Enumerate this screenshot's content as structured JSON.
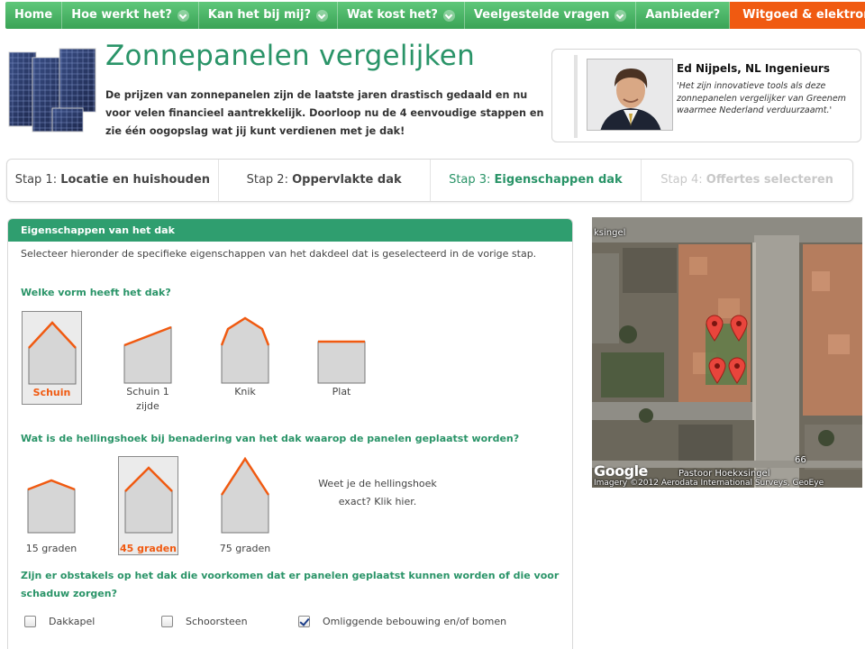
{
  "nav": {
    "items": [
      {
        "label": "Home",
        "dropdown": false
      },
      {
        "label": "Hoe werkt het?",
        "dropdown": true
      },
      {
        "label": "Kan het bij mij?",
        "dropdown": true
      },
      {
        "label": "Wat kost het?",
        "dropdown": true
      },
      {
        "label": "Veelgestelde vragen",
        "dropdown": true
      },
      {
        "label": "Aanbieder?",
        "dropdown": false
      }
    ],
    "cta": "Witgoed & elektronica"
  },
  "header": {
    "title": "Zonnepanelen vergelijken",
    "intro": "De prijzen van zonnepanelen zijn de laatste jaren drastisch gedaald en nu voor velen financieel aantrekkelijk. Doorloop nu de 4 eenvoudige stappen en zie één oogopslag wat jij kunt verdienen met je dak!"
  },
  "quote": {
    "name": "Ed Nijpels, NL Ingenieurs",
    "text": "'Het zijn innovatieve tools als deze zonnepanelen vergelijker van Greenem waarmee Nederland verduurzaamt.'"
  },
  "steps": [
    {
      "prefix": "Stap 1: ",
      "label": "Locatie en huishouden",
      "state": "done"
    },
    {
      "prefix": "Stap 2: ",
      "label": "Oppervlakte dak",
      "state": "done"
    },
    {
      "prefix": "Stap 3: ",
      "label": "Eigenschappen dak",
      "state": "active"
    },
    {
      "prefix": "Stap 4: ",
      "label": "Offertes selecteren",
      "state": "disabled"
    }
  ],
  "form": {
    "heading": "Eigenschappen van het dak",
    "subtitle": "Selecteer hieronder de specifieke eigenschappen van het dakdeel dat is geselecteerd in de vorige stap.",
    "q_shape": "Welke vorm heeft het dak?",
    "shapes": [
      {
        "label": "Schuin",
        "selected": true
      },
      {
        "label": "Schuin 1 zijde",
        "selected": false
      },
      {
        "label": "Knik",
        "selected": false
      },
      {
        "label": "Plat",
        "selected": false
      }
    ],
    "q_angle": "Wat is de hellingshoek bij benadering van het dak waarop de panelen geplaatst worden?",
    "angles": [
      {
        "label": "15 graden",
        "selected": false
      },
      {
        "label": "45 graden",
        "selected": true
      },
      {
        "label": "75 graden",
        "selected": false
      }
    ],
    "angle_exact_line1": "Weet je de hellingshoek",
    "angle_exact_line2": "exact? Klik hier.",
    "q_obstacles_line1": "Zijn er obstakels op het dak die voorkomen dat er panelen geplaatst kunnen worden of die voor",
    "q_obstacles_line2": "schaduw zorgen?",
    "obstacles": [
      {
        "label": "Dakkapel",
        "checked": false
      },
      {
        "label": "Schoorsteen",
        "checked": false
      },
      {
        "label": "Omliggende bebouwing en/of bomen",
        "checked": true
      }
    ]
  },
  "map": {
    "street_top": "ksingel",
    "street_bottom": "Pastoor Hoekxsingel",
    "house_number": "66",
    "logo": "Google",
    "copyright": "Imagery ©2012 Aerodata International Surveys, GeoEye"
  },
  "colors": {
    "brand_green": "#2a9468",
    "nav_green": "#3aa356",
    "accent_orange": "#f05a11"
  }
}
